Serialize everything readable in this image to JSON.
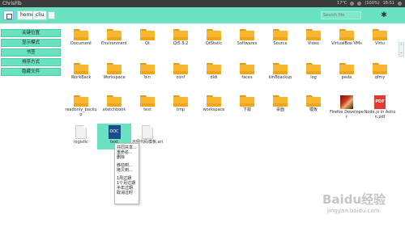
{
  "os_bar": {
    "title": "ChrisFib",
    "tray": [
      "17°C",
      "(100%)",
      "18:51"
    ]
  },
  "toolbar": {
    "crumbs": [
      "home",
      "cliu"
    ],
    "search_placeholder": "Search file"
  },
  "sidebar": {
    "items": [
      {
        "label": "关键位置"
      },
      {
        "label": "显示模式"
      },
      {
        "label": "书签"
      },
      {
        "label": "排序方式"
      },
      {
        "label": "隐藏文件"
      }
    ]
  },
  "files": [
    {
      "name": "Document",
      "type": "folder"
    },
    {
      "name": "Environment",
      "type": "folder"
    },
    {
      "name": "Qt",
      "type": "folder"
    },
    {
      "name": "Qt5.3.2",
      "type": "folder"
    },
    {
      "name": "QtStatic",
      "type": "folder"
    },
    {
      "name": "Softwares",
      "type": "folder"
    },
    {
      "name": "Source",
      "type": "folder"
    },
    {
      "name": "Video",
      "type": "folder"
    },
    {
      "name": "VirtualBox VMs",
      "type": "folder"
    },
    {
      "name": "Virtu",
      "type": "folder"
    },
    {
      "name": "WorkBack",
      "type": "folder"
    },
    {
      "name": "Workspace",
      "type": "folder"
    },
    {
      "name": "bin",
      "type": "folder"
    },
    {
      "name": "conf",
      "type": "folder"
    },
    {
      "name": "dldi",
      "type": "folder"
    },
    {
      "name": "faces",
      "type": "folder"
    },
    {
      "name": "kin8backup",
      "type": "folder"
    },
    {
      "name": "log",
      "type": "folder"
    },
    {
      "name": "peda",
      "type": "folder"
    },
    {
      "name": "qfmy",
      "type": "folder"
    },
    {
      "name": "readonly_backup",
      "type": "folder"
    },
    {
      "name": "sketchbook",
      "type": "folder"
    },
    {
      "name": "test",
      "type": "folder"
    },
    {
      "name": "tmp",
      "type": "folder"
    },
    {
      "name": "workspace",
      "type": "folder"
    },
    {
      "name": "下载",
      "type": "folder"
    },
    {
      "name": "桌面",
      "type": "folder"
    },
    {
      "name": "模板",
      "type": "folder"
    },
    {
      "name": "Firefox Developer",
      "type": "image"
    },
    {
      "name": "Node.js in Action.pdf",
      "type": "pdf",
      "badge": "PDF"
    },
    {
      "name": "logistic",
      "type": "doc"
    },
    {
      "name": "text",
      "type": "docblue",
      "badge": "DOC"
    },
    {
      "name": "示例代码模板.ari",
      "type": "doc"
    }
  ],
  "context_menu": {
    "groups": [
      [
        "共同共享...",
        "重命名...",
        "删除"
      ],
      [
        "移动到...",
        "拷贝到..."
      ],
      [
        "1周过期",
        "1个月过期",
        "半年过期",
        "取消过时"
      ]
    ]
  },
  "scroll_handle": [
    "⌃",
    "⌄"
  ],
  "watermark": {
    "logo": "Baidu经验",
    "url": "jingyan.baidu.com"
  },
  "colors": {
    "accent": "#68e2c0",
    "folder": "#f7b731",
    "pdf": "#e23b2e",
    "doc": "#1b4c8a"
  }
}
